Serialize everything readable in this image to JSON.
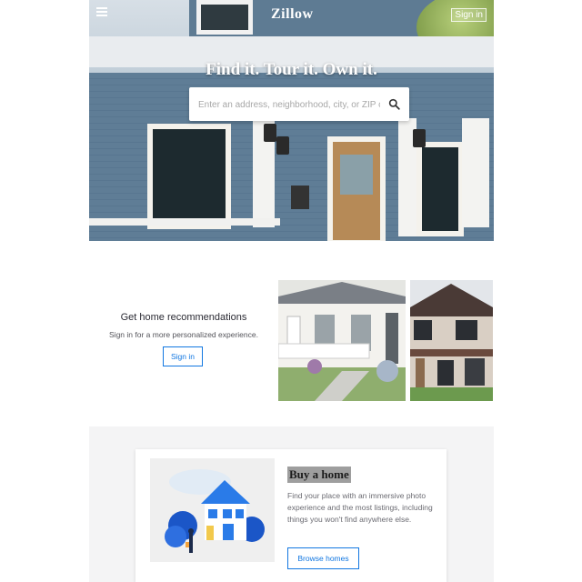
{
  "header": {
    "logo_text": "Zillow",
    "sign_in_label": "Sign in",
    "hero_title": "Find it. Tour it. Own it."
  },
  "search": {
    "placeholder": "Enter an address, neighborhood, city, or ZIP code"
  },
  "recommendations": {
    "title": "Get home recommendations",
    "subtitle": "Sign in for a more personalized experience.",
    "button_label": "Sign in"
  },
  "buy": {
    "title": "Buy a home",
    "description": "Find your place with an immersive photo experience and the most listings, including things you won't find anywhere else.",
    "button_label": "Browse homes"
  },
  "colors": {
    "accent": "#1277e1",
    "siding": "#5f7d96"
  },
  "icons": [
    "menu-icon",
    "search-icon"
  ]
}
